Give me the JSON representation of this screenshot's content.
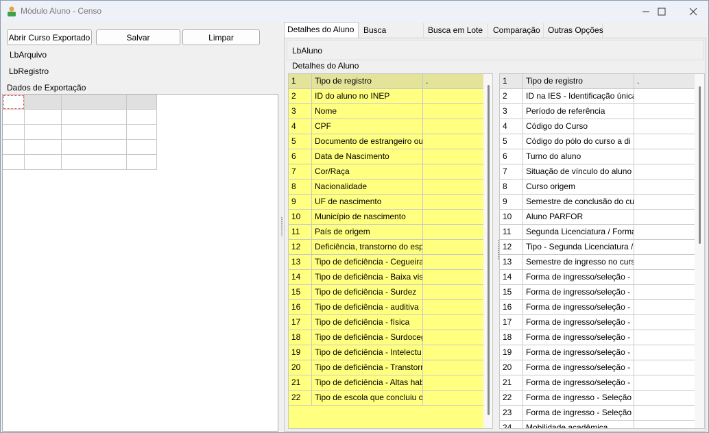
{
  "window": {
    "title": "Módulo Aluno - Censo",
    "controls": {
      "minimize": "—",
      "maximize": "☐",
      "close": "✕"
    }
  },
  "toolbar": {
    "open_label": "Abrir Curso Exportado",
    "save_label": "Salvar",
    "clear_label": "Limpar"
  },
  "labels": {
    "arquivo": "LbArquivo",
    "registro": "LbRegistro",
    "export_group": "Dados de Exportação"
  },
  "tabs": [
    "Detalhes do Aluno",
    "Busca",
    "Busca em Lote",
    "Comparação",
    "Outras Opções"
  ],
  "detail": {
    "lbaluno": "LbAluno",
    "group": "Detalhes do Aluno"
  },
  "left_grid": {
    "header": [
      "Tipo de registro",
      "."
    ],
    "rows": [
      [
        "1",
        "Tipo de registro",
        "."
      ],
      [
        "2",
        "ID do aluno no INEP",
        ""
      ],
      [
        "3",
        "Nome",
        ""
      ],
      [
        "4",
        "CPF",
        ""
      ],
      [
        "5",
        "Documento de estrangeiro ou",
        ""
      ],
      [
        "6",
        "Data de Nascimento",
        ""
      ],
      [
        "7",
        "Cor/Raça",
        ""
      ],
      [
        "8",
        "Nacionalidade",
        ""
      ],
      [
        "9",
        "UF de nascimento",
        ""
      ],
      [
        "10",
        "Município de nascimento",
        ""
      ],
      [
        "11",
        "País de origem",
        ""
      ],
      [
        "12",
        "Deficiência, transtorno do esp",
        ""
      ],
      [
        "13",
        "Tipo de deficiência - Cegueira",
        ""
      ],
      [
        "14",
        "Tipo de deficiência - Baixa vis",
        ""
      ],
      [
        "15",
        "Tipo de deficiência - Surdez",
        ""
      ],
      [
        "16",
        "Tipo de deficiência - auditiva",
        ""
      ],
      [
        "17",
        "Tipo de deficiência - física",
        ""
      ],
      [
        "18",
        "Tipo de deficiência - Surdoceg",
        ""
      ],
      [
        "19",
        "Tipo de deficiência - Intelectu",
        ""
      ],
      [
        "20",
        "Tipo de deficiência - Transtorr",
        ""
      ],
      [
        "21",
        "Tipo de deficiência - Altas hab",
        ""
      ],
      [
        "22",
        "Tipo de escola que concluiu o",
        ""
      ]
    ]
  },
  "right_grid": {
    "rows": [
      [
        "1",
        "Tipo de registro",
        "."
      ],
      [
        "2",
        "ID na IES - Identificação única",
        ""
      ],
      [
        "3",
        "Período de referência",
        ""
      ],
      [
        "4",
        "Código do Curso",
        ""
      ],
      [
        "5",
        "Código do pólo do curso a di",
        ""
      ],
      [
        "6",
        "Turno do aluno",
        ""
      ],
      [
        "7",
        "Situação de vínculo do aluno",
        ""
      ],
      [
        "8",
        "Curso origem",
        ""
      ],
      [
        "9",
        "Semestre de conclusão do cu",
        ""
      ],
      [
        "10",
        "Aluno PARFOR",
        ""
      ],
      [
        "11",
        "Segunda Licenciatura / Forma",
        ""
      ],
      [
        "12",
        "Tipo - Segunda Licenciatura /",
        ""
      ],
      [
        "13",
        "Semestre de ingresso no curs",
        ""
      ],
      [
        "14",
        "Forma de ingresso/seleção  -",
        ""
      ],
      [
        "15",
        "Forma de ingresso/seleção  -",
        ""
      ],
      [
        "16",
        "Forma de ingresso/seleção  -",
        ""
      ],
      [
        "17",
        "Forma de ingresso/seleção  -",
        ""
      ],
      [
        "18",
        "Forma de ingresso/seleção  -",
        ""
      ],
      [
        "19",
        "Forma de ingresso/seleção  -",
        ""
      ],
      [
        "20",
        "Forma de ingresso/seleção  -",
        ""
      ],
      [
        "21",
        "Forma de ingresso/seleção  -",
        ""
      ],
      [
        "22",
        "Forma de ingresso  - Seleção",
        ""
      ],
      [
        "23",
        "Forma de ingresso  - Seleção",
        ""
      ],
      [
        "24",
        "Mobilidade acadêmica",
        ""
      ]
    ]
  },
  "colors": {
    "yellow": "#ffff80",
    "yellow_header": "#e3e39a",
    "selection_row": "#e8e8e8"
  }
}
